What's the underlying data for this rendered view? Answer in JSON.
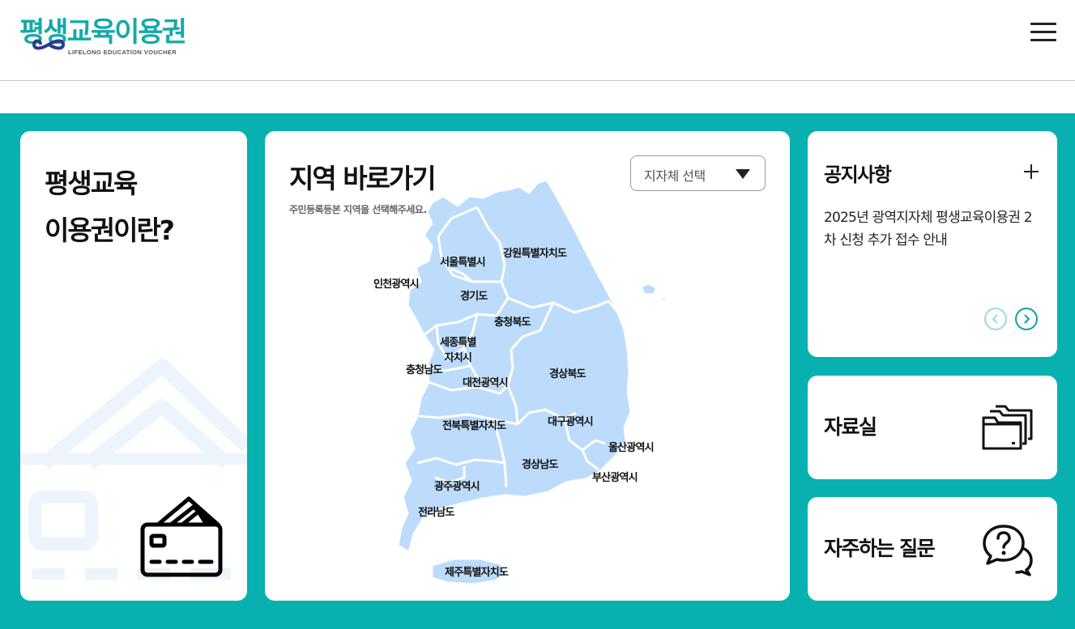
{
  "header": {
    "logo_text": "평생교육이용권",
    "logo_subtext": "LIFELONG EDUCATION VOUCHER"
  },
  "intro_card": {
    "title": "평생교육\n이용권이란?"
  },
  "map_card": {
    "title": "지역 바로가기",
    "subtitle": "주민등록등본 지역을 선택해주세요.",
    "select_label": "지자체 선택",
    "regions": [
      {
        "id": "seoul",
        "label": "서울특별시"
      },
      {
        "id": "gangwon",
        "label": "강원특별자치도"
      },
      {
        "id": "incheon",
        "label": "인천광역시"
      },
      {
        "id": "gyeonggi",
        "label": "경기도"
      },
      {
        "id": "chungbuk",
        "label": "충청북도"
      },
      {
        "id": "sejong",
        "label": "세종특별\n자치시"
      },
      {
        "id": "chungnam",
        "label": "충청남도"
      },
      {
        "id": "daejeon",
        "label": "대전광역시"
      },
      {
        "id": "gyeongbuk",
        "label": "경상북도"
      },
      {
        "id": "jeonbuk",
        "label": "전북특별자치도"
      },
      {
        "id": "daegu",
        "label": "대구광역시"
      },
      {
        "id": "ulsan",
        "label": "울산광역시"
      },
      {
        "id": "gyeongnam",
        "label": "경상남도"
      },
      {
        "id": "busan",
        "label": "부산광역시"
      },
      {
        "id": "gwangju",
        "label": "광주광역시"
      },
      {
        "id": "jeonnam",
        "label": "전라남도"
      },
      {
        "id": "jeju",
        "label": "제주특별자치도"
      }
    ]
  },
  "notice_card": {
    "title": "공지사항",
    "item": "2025년 광역지자체 평생교육이용권 2차 신청 추가 접수 안내"
  },
  "docs_card": {
    "title": "자료실"
  },
  "faq_card": {
    "title": "자주하는 질문"
  },
  "colors": {
    "teal": "#08b0b0",
    "logo_teal": "#16a9a9",
    "logo_navy": "#2b3a8f",
    "map_fill": "#bddcfb"
  }
}
